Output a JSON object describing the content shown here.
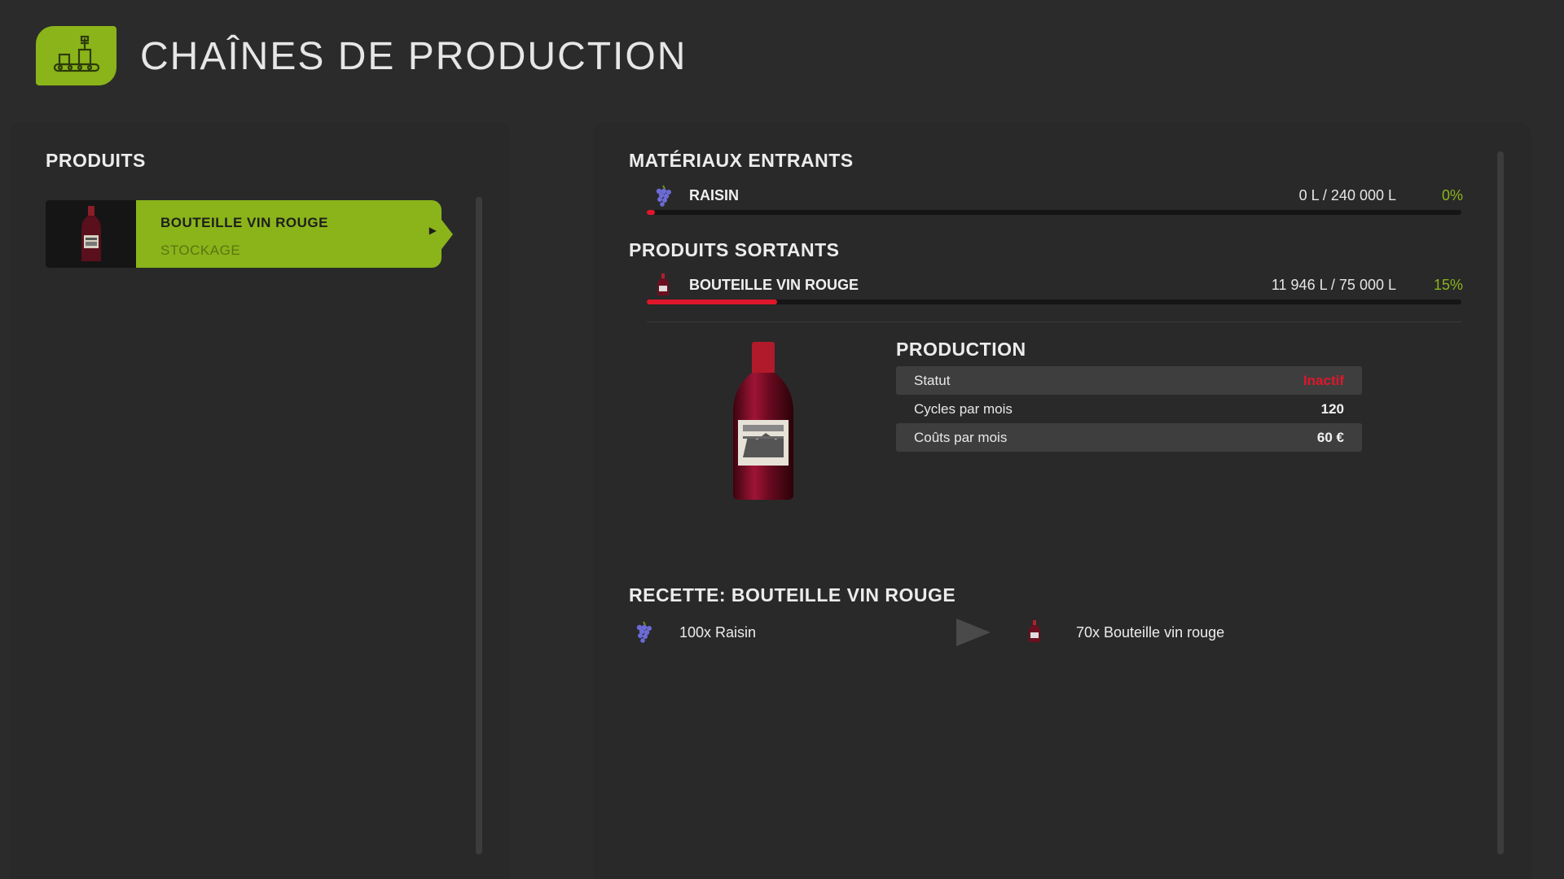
{
  "header": {
    "title": "CHAÎNES DE PRODUCTION",
    "icon": "production-line-icon",
    "accent_color": "#8ab41a"
  },
  "products_panel": {
    "title": "PRODUITS",
    "items": [
      {
        "name": "BOUTEILLE VIN ROUGE",
        "subtitle": "STOCKAGE",
        "icon": "wine-bottle-icon",
        "selected": true
      }
    ]
  },
  "inputs": {
    "title": "MATÉRIAUX ENTRANTS",
    "items": [
      {
        "name": "RAISIN",
        "amount": "0 L / 240 000 L",
        "percent": "0%",
        "fill_fraction": 0.0,
        "icon": "grapes-icon"
      }
    ]
  },
  "outputs": {
    "title": "PRODUITS SORTANTS",
    "items": [
      {
        "name": "BOUTEILLE VIN ROUGE",
        "amount": "11 946 L / 75 000 L",
        "percent": "15%",
        "fill_fraction": 0.16,
        "icon": "wine-bottle-icon"
      }
    ]
  },
  "production": {
    "title": "PRODUCTION",
    "image": "red-wine-bottle-image",
    "rows": [
      {
        "label": "Statut",
        "value": "Inactif",
        "status_color": "#e0162b"
      },
      {
        "label": "Cycles par mois",
        "value": "120"
      },
      {
        "label": "Coûts par mois",
        "value": "60 €"
      }
    ]
  },
  "recipe": {
    "title": "RECETTE: BOUTEILLE VIN ROUGE",
    "input": {
      "label": "100x Raisin",
      "icon": "grapes-icon"
    },
    "output": {
      "label": "70x Bouteille vin rouge",
      "icon": "wine-bottle-icon"
    },
    "arrow_icon": "play-arrow-icon"
  }
}
